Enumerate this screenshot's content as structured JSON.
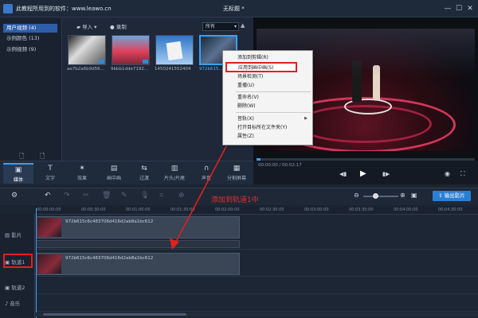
{
  "window": {
    "watermark": "此教程所用到的软件：www.leawo.cn",
    "title": "无标题 *",
    "min": "—",
    "max": "☐",
    "close": "✕"
  },
  "sidebar": {
    "items": [
      {
        "label": "用户视频 (4)",
        "active": true
      },
      {
        "label": "示例颜色 (13)",
        "active": false
      },
      {
        "label": "示例视频 (9)",
        "active": false
      }
    ]
  },
  "media_toolbar": {
    "import_label": "导入",
    "record_label": "录制",
    "filter_value": "所有"
  },
  "thumbnails": [
    {
      "caption": "ae7b2a6b9d56...",
      "selected": false
    },
    {
      "caption": "9bbb1dde7192...",
      "selected": false
    },
    {
      "caption": "1450241552404",
      "selected": false
    },
    {
      "caption": "972b615...",
      "selected": true
    }
  ],
  "context_menu": {
    "items": [
      {
        "label": "添加到剪辑(R)",
        "highlight": false
      },
      {
        "label": "应用到画中画(S)",
        "highlight": true
      },
      {
        "label": "场景检测(T)",
        "highlight": false
      },
      {
        "label": "重播(U)",
        "highlight": false
      },
      {
        "label": "重命名(V)",
        "highlight": false
      },
      {
        "label": "删除(W)",
        "highlight": false
      },
      {
        "label": "音轨(X)",
        "highlight": false,
        "submenu": true
      },
      {
        "label": "打开目标所在文件夹(Y)",
        "highlight": false
      },
      {
        "label": "属性(Z)",
        "highlight": false
      }
    ]
  },
  "player": {
    "time": "00:00:00 / 00:02:17",
    "progress_fraction": 0.02
  },
  "tabs": [
    {
      "label": "媒体",
      "icon": "▣",
      "active": true
    },
    {
      "label": "文字",
      "icon": "T",
      "active": false
    },
    {
      "label": "效果",
      "icon": "✶",
      "active": false
    },
    {
      "label": "画中画",
      "icon": "▤",
      "active": false
    },
    {
      "label": "过渡",
      "icon": "⇆",
      "active": false
    },
    {
      "label": "片头/片尾",
      "icon": "▥",
      "active": false
    },
    {
      "label": "声音",
      "icon": "∩",
      "active": false
    },
    {
      "label": "分割屏幕",
      "icon": "▦",
      "active": false
    }
  ],
  "timeline": {
    "export_label": "输出影片",
    "annotation": "添加到轨道1中",
    "ticks": [
      "00:00:00:00",
      "00:00:30:00",
      "00:01:00:00",
      "00:01:30:00",
      "00:02:00:00",
      "00:02:30:00",
      "00:03:00:00",
      "00:03:30:00",
      "00:04:00:00",
      "00:04:30:00"
    ],
    "tracks": [
      {
        "label": "影片",
        "clip": "972b615c6c483706d416d2ab8a1bc612"
      },
      {
        "label": "轨道1",
        "clip": "972b615c6c483706d416d2ab8a1bc612"
      },
      {
        "label": "轨道2",
        "clip": ""
      },
      {
        "label": "音乐",
        "clip": ""
      }
    ]
  }
}
